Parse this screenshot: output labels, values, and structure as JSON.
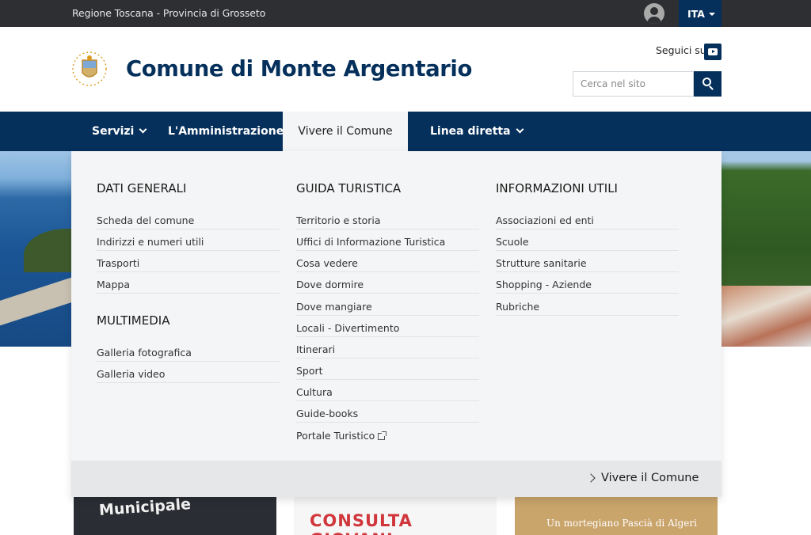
{
  "topbar": {
    "region": "Regione Toscana - Provincia di Grosseto",
    "language": "ITA"
  },
  "header": {
    "site_title": "Comune di Monte Argentario",
    "follow_label": "Seguici su",
    "search_placeholder": "Cerca nel sito",
    "social_icon": "youtube-icon"
  },
  "nav": {
    "items": [
      {
        "label": "Servizi",
        "has_dropdown": true
      },
      {
        "label": "L'Amministrazione",
        "has_dropdown": true
      },
      {
        "label": "Vivere il Comune",
        "active": true
      },
      {
        "label": "Linea diretta",
        "has_dropdown": true
      }
    ]
  },
  "mega_menu": {
    "columns": [
      {
        "sections": [
          {
            "title": "DATI GENERALI",
            "links": [
              "Scheda del comune",
              "Indirizzi e numeri utili",
              "Trasporti",
              "Mappa"
            ]
          },
          {
            "title": "MULTIMEDIA",
            "links": [
              "Galleria fotografica",
              "Galleria video"
            ]
          }
        ]
      },
      {
        "sections": [
          {
            "title": "GUIDA TURISTICA",
            "links": [
              "Territorio e storia",
              "Uffici di Informazione Turistica",
              "Cosa vedere",
              "Dove dormire",
              "Dove mangiare",
              "Locali - Divertimento",
              "Itinerari",
              "Sport",
              "Cultura",
              "Guide-books",
              "Portale Turistico"
            ]
          }
        ]
      },
      {
        "sections": [
          {
            "title": "INFORMAZIONI UTILI",
            "links": [
              "Associazioni ed enti",
              "Scuole",
              "Strutture sanitarie",
              "Shopping - Aziende",
              "Rubriche"
            ]
          }
        ]
      }
    ],
    "footer_link": "Vivere il Comune"
  },
  "cards": [
    {
      "text": "Municipale"
    },
    {
      "text": "CONSULTA GIOVANI"
    },
    {
      "text": "Un mortegiano Pascià di Algeri"
    }
  ],
  "colors": {
    "primary": "#06305c",
    "topbar": "#2d2f33",
    "menu_bg": "#f4f5f6"
  }
}
